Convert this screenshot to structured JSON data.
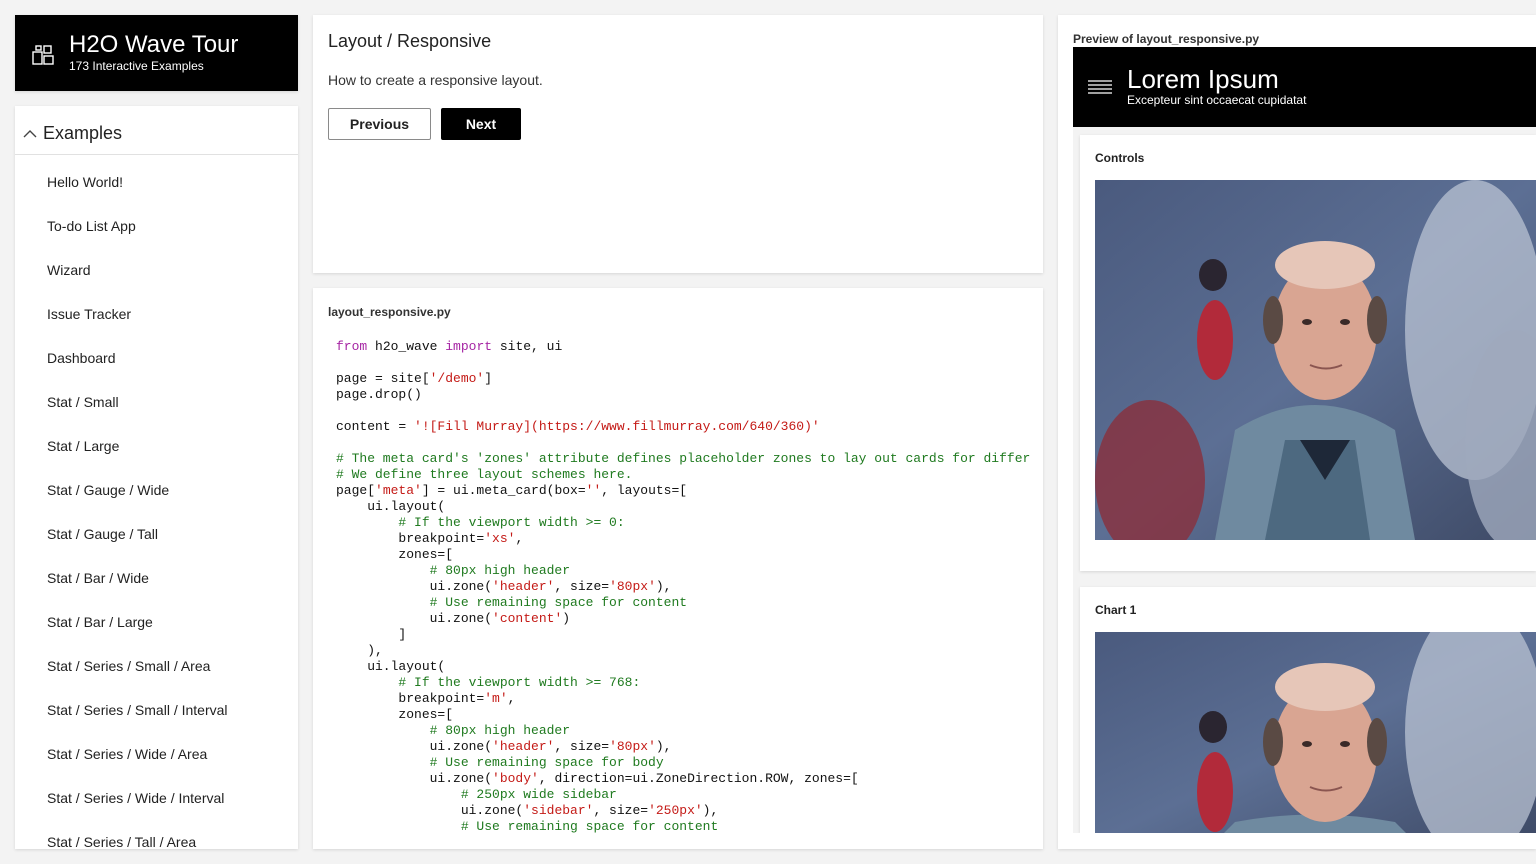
{
  "app": {
    "title": "H2O Wave Tour",
    "subtitle": "173 Interactive Examples",
    "logo_icon": "grid-tiles-icon"
  },
  "nav": {
    "group_label": "Examples",
    "group_icon": "chevron-up-icon",
    "items": [
      {
        "label": "Hello World!"
      },
      {
        "label": "To-do List App"
      },
      {
        "label": "Wizard"
      },
      {
        "label": "Issue Tracker"
      },
      {
        "label": "Dashboard"
      },
      {
        "label": "Stat / Small"
      },
      {
        "label": "Stat / Large"
      },
      {
        "label": "Stat / Gauge / Wide"
      },
      {
        "label": "Stat / Gauge / Tall"
      },
      {
        "label": "Stat / Bar / Wide"
      },
      {
        "label": "Stat / Bar / Large"
      },
      {
        "label": "Stat / Series / Small / Area"
      },
      {
        "label": "Stat / Series / Small / Interval"
      },
      {
        "label": "Stat / Series / Wide / Area"
      },
      {
        "label": "Stat / Series / Wide / Interval"
      },
      {
        "label": "Stat / Series / Tall / Area"
      }
    ]
  },
  "example": {
    "title": "Layout / Responsive",
    "description": "How to create a responsive layout.",
    "previous_label": "Previous",
    "next_label": "Next"
  },
  "code": {
    "filename": "layout_responsive.py",
    "lines": [
      [
        [
          "kw",
          "from"
        ],
        [
          "n",
          " h2o_wave "
        ],
        [
          "kw",
          "import"
        ],
        [
          "n",
          " site, ui"
        ]
      ],
      [],
      [
        [
          "n",
          "page = site["
        ],
        [
          "str",
          "'/demo'"
        ],
        [
          "n",
          "]"
        ]
      ],
      [
        [
          "n",
          "page.drop()"
        ]
      ],
      [],
      [
        [
          "n",
          "content = "
        ],
        [
          "str",
          "'![Fill Murray](https://www.fillmurray.com/640/360)'"
        ]
      ],
      [],
      [
        [
          "cm",
          "# The meta card's 'zones' attribute defines placeholder zones to lay out cards for differ"
        ]
      ],
      [
        [
          "cm",
          "# We define three layout schemes here."
        ]
      ],
      [
        [
          "n",
          "page["
        ],
        [
          "str",
          "'meta'"
        ],
        [
          "n",
          "] = ui.meta_card(box="
        ],
        [
          "str",
          "''"
        ],
        [
          "n",
          ", layouts=["
        ]
      ],
      [
        [
          "n",
          "    ui.layout("
        ]
      ],
      [
        [
          "cm",
          "        # If the viewport width >= 0:"
        ]
      ],
      [
        [
          "n",
          "        breakpoint="
        ],
        [
          "str",
          "'xs'"
        ],
        [
          "n",
          ","
        ]
      ],
      [
        [
          "n",
          "        zones=["
        ]
      ],
      [
        [
          "cm",
          "            # 80px high header"
        ]
      ],
      [
        [
          "n",
          "            ui.zone("
        ],
        [
          "str",
          "'header'"
        ],
        [
          "n",
          ", size="
        ],
        [
          "str",
          "'80px'"
        ],
        [
          "n",
          "),"
        ]
      ],
      [
        [
          "cm",
          "            # Use remaining space for content"
        ]
      ],
      [
        [
          "n",
          "            ui.zone("
        ],
        [
          "str",
          "'content'"
        ],
        [
          "n",
          ")"
        ]
      ],
      [
        [
          "n",
          "        ]"
        ]
      ],
      [
        [
          "n",
          "    ),"
        ]
      ],
      [
        [
          "n",
          "    ui.layout("
        ]
      ],
      [
        [
          "cm",
          "        # If the viewport width >= 768:"
        ]
      ],
      [
        [
          "n",
          "        breakpoint="
        ],
        [
          "str",
          "'m'"
        ],
        [
          "n",
          ","
        ]
      ],
      [
        [
          "n",
          "        zones=["
        ]
      ],
      [
        [
          "cm",
          "            # 80px high header"
        ]
      ],
      [
        [
          "n",
          "            ui.zone("
        ],
        [
          "str",
          "'header'"
        ],
        [
          "n",
          ", size="
        ],
        [
          "str",
          "'80px'"
        ],
        [
          "n",
          "),"
        ]
      ],
      [
        [
          "cm",
          "            # Use remaining space for body"
        ]
      ],
      [
        [
          "n",
          "            ui.zone("
        ],
        [
          "str",
          "'body'"
        ],
        [
          "n",
          ", direction=ui.ZoneDirection.ROW, zones=["
        ]
      ],
      [
        [
          "cm",
          "                # 250px wide sidebar"
        ]
      ],
      [
        [
          "n",
          "                ui.zone("
        ],
        [
          "str",
          "'sidebar'"
        ],
        [
          "n",
          ", size="
        ],
        [
          "str",
          "'250px'"
        ],
        [
          "n",
          "),"
        ]
      ],
      [
        [
          "cm",
          "                # Use remaining space for content"
        ]
      ]
    ]
  },
  "preview": {
    "label": "Preview of layout_responsive.py",
    "header_title": "Lorem Ipsum",
    "header_subtitle": "Excepteur sint occaecat cupidatat",
    "menu_icon": "hamburger-menu-icon",
    "cards": [
      {
        "title": "Controls"
      },
      {
        "title": "Chart 1"
      }
    ]
  },
  "colors": {
    "keyword": "#a626a4",
    "string": "#c41a16",
    "comment": "#1f7a1f",
    "header_bg": "#000000",
    "page_bg": "#f3f3f3"
  }
}
